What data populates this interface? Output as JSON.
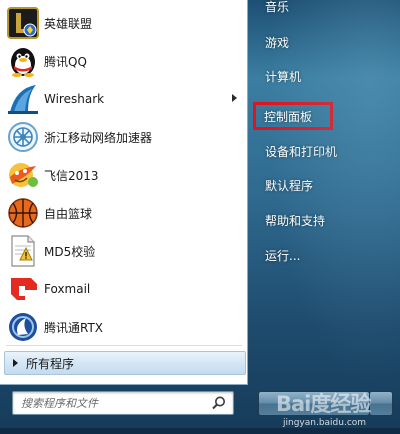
{
  "programs": [
    {
      "label": "英雄联盟",
      "icon": "league-of-legends-icon"
    },
    {
      "label": "腾讯QQ",
      "icon": "qq-penguin-icon"
    },
    {
      "label": "Wireshark",
      "icon": "wireshark-fin-icon",
      "has_submenu": true
    },
    {
      "label": "浙江移动网络加速器",
      "icon": "network-accelerator-icon"
    },
    {
      "label": "飞信2013",
      "icon": "fetion-icon"
    },
    {
      "label": "自由篮球",
      "icon": "basketball-icon"
    },
    {
      "label": "MD5校验",
      "icon": "md5-document-icon"
    },
    {
      "label": "Foxmail",
      "icon": "foxmail-icon"
    },
    {
      "label": "腾讯通RTX",
      "icon": "rtx-icon"
    }
  ],
  "all_programs_label": "所有程序",
  "search": {
    "placeholder": "搜索程序和文件"
  },
  "right_items": [
    {
      "label": "音乐"
    },
    {
      "label": "游戏"
    },
    {
      "label": "计算机"
    },
    {
      "label": "控制面板",
      "highlighted": true
    },
    {
      "label": "设备和打印机"
    },
    {
      "label": "默认程序"
    },
    {
      "label": "帮助和支持"
    },
    {
      "label": "运行..."
    }
  ],
  "watermark": {
    "text": "Bai度经验",
    "url": "jingyan.baidu.com"
  },
  "colors": {
    "highlight_border": "#e0141e",
    "menu_blue": "#2f6a8f"
  }
}
